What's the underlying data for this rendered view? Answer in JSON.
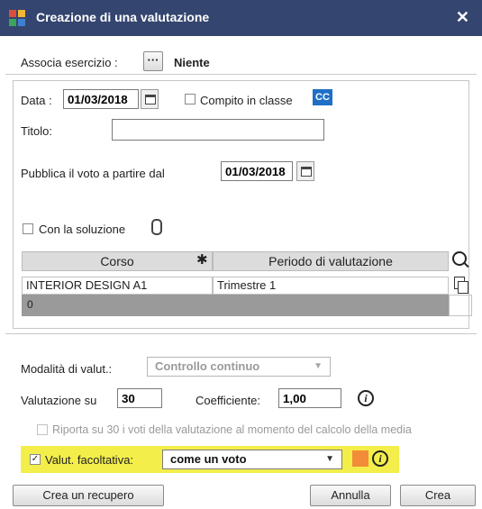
{
  "window": {
    "title": "Creazione di una valutazione",
    "close_glyph": "✕"
  },
  "associa": {
    "label": "Associa esercizio :",
    "button": "···",
    "value": "Niente"
  },
  "data": {
    "label": "Data :",
    "value": "01/03/2018"
  },
  "compito": {
    "label": "Compito in classe",
    "badge": "CC",
    "checked": false
  },
  "titolo": {
    "label": "Titolo:",
    "value": ""
  },
  "pubblica": {
    "label": "Pubblica il voto a partire dal",
    "value": "01/03/2018"
  },
  "soluzione": {
    "label": "Con la soluzione",
    "checked": false
  },
  "grid": {
    "headers": [
      "Corso",
      "Periodo di valutazione"
    ],
    "rows": [
      {
        "corso": "INTERIOR DESIGN A1",
        "periodo": "Trimestre 1"
      }
    ],
    "total": "0"
  },
  "modalita": {
    "label": "Modalità di valut.:",
    "value": "Controllo continuo"
  },
  "valutazione_su": {
    "label": "Valutazione su",
    "value": "30"
  },
  "coefficiente": {
    "label": "Coefficiente:",
    "value": "1,00"
  },
  "riporta": {
    "label": "Riporta su 30 i voti della valutazione al momento del calcolo della media",
    "checked": false
  },
  "facoltativa": {
    "label": "Valut. facoltativa:",
    "checked": true,
    "value": "come un voto",
    "swatch_color": "#f28c38"
  },
  "buttons": {
    "recupero": "Crea un recupero",
    "annulla": "Annulla",
    "crea": "Crea"
  },
  "colors": {
    "titlebar": "#34456f",
    "highlight": "#f3ee4a",
    "cc_badge": "#1f6fc7"
  }
}
